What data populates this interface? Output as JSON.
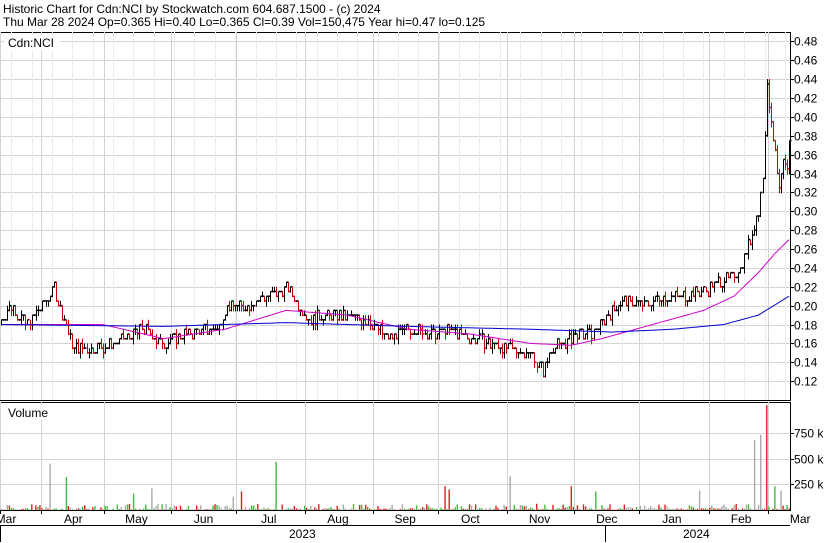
{
  "header": {
    "line1": "Historic Chart for Cdn:NCI by Stockwatch.com 604.687.1500 - (c) 2024",
    "line2": "Thu Mar 28 2024   Op=0.365   Hi=0.40   Lo=0.365   Cl=0.39   Vol=150,475   Year hi=0.47   lo=0.125"
  },
  "colors": {
    "up": "#000000",
    "down": "#cc0000",
    "ma_short": "#cc00cc",
    "ma_long": "#0000cc",
    "vol_up": "#44bb44",
    "vol_down": "#dd2222",
    "vol_neutral": "#aaaaaa",
    "grid": "#d4d4d4"
  },
  "chart_data": [
    {
      "type": "ohlc",
      "title": "Cdn:NCI",
      "ylim": [
        0.1,
        0.49
      ],
      "yticks": [
        "0.12",
        "0.14",
        "0.16",
        "0.18",
        "0.20",
        "0.22",
        "0.24",
        "0.26",
        "0.28",
        "0.30",
        "0.32",
        "0.34",
        "0.36",
        "0.38",
        "0.40",
        "0.42",
        "0.44",
        "0.46",
        "0.48"
      ],
      "price_anchors": [
        [
          0,
          0.185
        ],
        [
          5,
          0.2
        ],
        [
          12,
          0.18
        ],
        [
          20,
          0.2
        ],
        [
          26,
          0.22
        ],
        [
          30,
          0.19
        ],
        [
          36,
          0.155
        ],
        [
          50,
          0.155
        ],
        [
          60,
          0.165
        ],
        [
          70,
          0.175
        ],
        [
          78,
          0.16
        ],
        [
          90,
          0.17
        ],
        [
          100,
          0.175
        ],
        [
          106,
          0.175
        ],
        [
          111,
          0.2
        ],
        [
          120,
          0.2
        ],
        [
          130,
          0.21
        ],
        [
          137,
          0.215
        ],
        [
          141,
          0.22
        ],
        [
          146,
          0.2
        ],
        [
          152,
          0.185
        ],
        [
          160,
          0.19
        ],
        [
          168,
          0.19
        ],
        [
          180,
          0.185
        ],
        [
          190,
          0.165
        ],
        [
          200,
          0.175
        ],
        [
          212,
          0.17
        ],
        [
          220,
          0.175
        ],
        [
          230,
          0.165
        ],
        [
          240,
          0.16
        ],
        [
          250,
          0.155
        ],
        [
          260,
          0.15
        ],
        [
          266,
          0.13
        ],
        [
          270,
          0.155
        ],
        [
          276,
          0.16
        ],
        [
          282,
          0.17
        ],
        [
          290,
          0.17
        ],
        [
          298,
          0.19
        ],
        [
          305,
          0.205
        ],
        [
          315,
          0.2
        ],
        [
          325,
          0.21
        ],
        [
          335,
          0.21
        ],
        [
          345,
          0.215
        ],
        [
          352,
          0.225
        ],
        [
          358,
          0.23
        ],
        [
          363,
          0.24
        ],
        [
          368,
          0.27
        ],
        [
          372,
          0.3
        ],
        [
          374,
          0.34
        ],
        [
          376,
          0.43
        ],
        [
          378,
          0.4
        ],
        [
          380,
          0.36
        ],
        [
          382,
          0.32
        ],
        [
          384,
          0.35
        ],
        [
          386,
          0.34
        ],
        [
          387,
          0.38
        ]
      ],
      "volume_spikes": [
        [
          24,
          450
        ],
        [
          32,
          320
        ],
        [
          65,
          160
        ],
        [
          74,
          210
        ],
        [
          114,
          130
        ],
        [
          118,
          180
        ],
        [
          135,
          470
        ],
        [
          218,
          230
        ],
        [
          220,
          200
        ],
        [
          250,
          330
        ],
        [
          280,
          230
        ],
        [
          292,
          180
        ],
        [
          343,
          190
        ],
        [
          370,
          680
        ],
        [
          373,
          730
        ],
        [
          376,
          1020
        ],
        [
          380,
          230
        ],
        [
          383,
          190
        ]
      ],
      "ma_short_anchors": [
        [
          0,
          0.18
        ],
        [
          50,
          0.18
        ],
        [
          80,
          0.165
        ],
        [
          110,
          0.175
        ],
        [
          140,
          0.195
        ],
        [
          170,
          0.19
        ],
        [
          200,
          0.175
        ],
        [
          230,
          0.17
        ],
        [
          260,
          0.16
        ],
        [
          280,
          0.158
        ],
        [
          295,
          0.165
        ],
        [
          320,
          0.18
        ],
        [
          345,
          0.195
        ],
        [
          360,
          0.21
        ],
        [
          372,
          0.235
        ],
        [
          380,
          0.255
        ],
        [
          387,
          0.27
        ]
      ],
      "ma_long_anchors": [
        [
          0,
          0.18
        ],
        [
          80,
          0.178
        ],
        [
          140,
          0.182
        ],
        [
          200,
          0.178
        ],
        [
          260,
          0.175
        ],
        [
          300,
          0.172
        ],
        [
          330,
          0.175
        ],
        [
          355,
          0.18
        ],
        [
          372,
          0.19
        ],
        [
          387,
          0.21
        ]
      ],
      "total_bars": 388
    },
    {
      "type": "bar",
      "title": "Volume",
      "ylim": [
        0,
        1050
      ],
      "yticks": [
        "250 k",
        "500 k",
        "750 k"
      ]
    }
  ],
  "x_axis": {
    "months": [
      {
        "label": "Mar",
        "bar": 0
      },
      {
        "label": "Apr",
        "bar": 20
      },
      {
        "label": "May",
        "bar": 51
      },
      {
        "label": "Jun",
        "bar": 84
      },
      {
        "label": "Jul",
        "bar": 116
      },
      {
        "label": "Aug",
        "bar": 150
      },
      {
        "label": "Sep",
        "bar": 183
      },
      {
        "label": "Oct",
        "bar": 215
      },
      {
        "label": "Nov",
        "bar": 249
      },
      {
        "label": "Dec",
        "bar": 282
      },
      {
        "label": "Jan",
        "bar": 314
      },
      {
        "label": "Feb",
        "bar": 348
      },
      {
        "label": "Mar",
        "bar": 377
      }
    ],
    "years": [
      {
        "label": "2023",
        "from": 0,
        "to": 297
      },
      {
        "label": "2024",
        "from": 297,
        "to": 387
      }
    ]
  }
}
